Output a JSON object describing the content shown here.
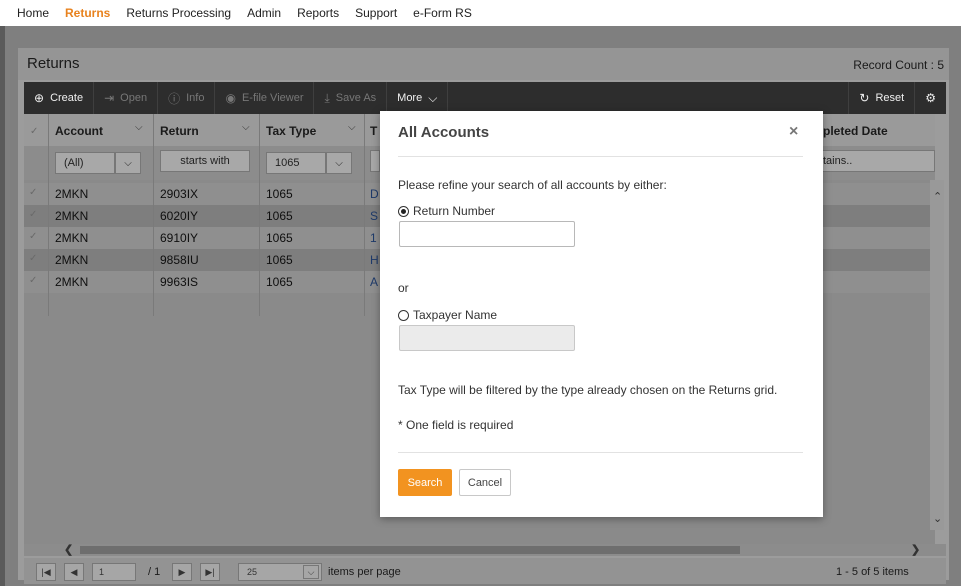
{
  "nav": [
    "Home",
    "Returns",
    "Returns Processing",
    "Admin",
    "Reports",
    "Support",
    "e-Form RS"
  ],
  "active_nav": "Returns",
  "panel": {
    "title": "Returns",
    "record_count": "Record Count : 5"
  },
  "toolbar": {
    "create": "Create",
    "open": "Open",
    "info": "Info",
    "efile_viewer": "E-file Viewer",
    "save_as": "Save As",
    "more": "More",
    "reset": "Reset"
  },
  "grid": {
    "headers": {
      "account": "Account",
      "return": "Return",
      "tax_type": "Tax Type",
      "t": "T",
      "completed_date": "pleted Date"
    },
    "filters": {
      "account": "(All)",
      "return": "starts with",
      "tax_type": "1065",
      "completed": "tains.."
    },
    "rows": [
      {
        "account": "2MKN",
        "return": "2903IX",
        "tax_type": "1065",
        "t": "D"
      },
      {
        "account": "2MKN",
        "return": "6020IY",
        "tax_type": "1065",
        "t": "S"
      },
      {
        "account": "2MKN",
        "return": "6910IY",
        "tax_type": "1065",
        "t": "1"
      },
      {
        "account": "2MKN",
        "return": "9858IU",
        "tax_type": "1065",
        "t": "H"
      },
      {
        "account": "2MKN",
        "return": "9963IS",
        "tax_type": "1065",
        "t": "A"
      }
    ]
  },
  "pager": {
    "page": "1",
    "of": "/ 1",
    "page_size": "25",
    "items_per_page": "items per page",
    "summary": "1 - 5 of 5 items"
  },
  "modal": {
    "title": "All Accounts",
    "close": "×",
    "intro": "Please refine your search of all accounts by either:",
    "option_return": "Return Number",
    "or": "or",
    "option_taxpayer": "Taxpayer Name",
    "note_tax_type": "Tax Type will be filtered by the type already chosen on the Returns grid.",
    "note_required": "* One field is required",
    "search": "Search",
    "cancel": "Cancel"
  },
  "colors": {
    "accent": "#e8821e",
    "search_button": "#f29320",
    "toolbar": "#2d2d2d"
  }
}
